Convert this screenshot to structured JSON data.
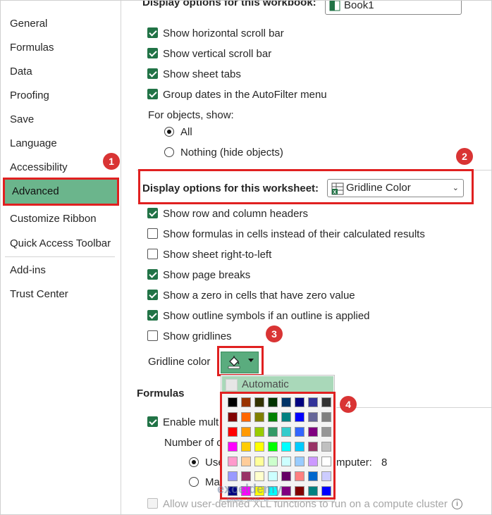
{
  "sidebar": {
    "items": [
      {
        "label": "General"
      },
      {
        "label": "Formulas"
      },
      {
        "label": "Data"
      },
      {
        "label": "Proofing"
      },
      {
        "label": "Save"
      },
      {
        "label": "Language"
      },
      {
        "label": "Accessibility"
      },
      {
        "label": "Advanced"
      },
      {
        "label": "Customize Ribbon"
      },
      {
        "label": "Quick Access Toolbar"
      },
      {
        "label": "Add-ins"
      },
      {
        "label": "Trust Center"
      }
    ],
    "active": "Advanced"
  },
  "top_cut": {
    "heading": "Display options for this workbook:",
    "combo_value": "Book1"
  },
  "workbook_options": [
    {
      "label": "Show horizontal scroll bar",
      "checked": true
    },
    {
      "label": "Show vertical scroll bar",
      "checked": true
    },
    {
      "label": "Show sheet tabs",
      "checked": true
    },
    {
      "label": "Group dates in the AutoFilter menu",
      "checked": true
    }
  ],
  "objects": {
    "label": "For objects, show:",
    "options": [
      {
        "label": "All",
        "selected": true
      },
      {
        "label": "Nothing (hide objects)",
        "selected": false
      }
    ]
  },
  "worksheet": {
    "heading": "Display options for this worksheet:",
    "combo_value": "Gridline Color",
    "options": [
      {
        "label": "Show row and column headers",
        "checked": true
      },
      {
        "label": "Show formulas in cells instead of their calculated results",
        "checked": false
      },
      {
        "label": "Show sheet right-to-left",
        "checked": false
      },
      {
        "label": "Show page breaks",
        "checked": true
      },
      {
        "label": "Show a zero in cells that have zero value",
        "checked": true
      },
      {
        "label": "Show outline symbols if an outline is applied",
        "checked": true
      },
      {
        "label": "Show gridlines",
        "checked": false
      }
    ],
    "gridline_color_label": "Gridline color"
  },
  "formulas": {
    "heading": "Formulas",
    "enable_multithread": "Enable mult",
    "number_of": "Number of c",
    "use_all": "Use",
    "computer_label": "mputer:",
    "computer_value": "8",
    "manual": "Ma",
    "allow_udf": "Allow user-defined XLL functions to run on a compute cluster",
    "info_icon": "i"
  },
  "palette": {
    "automatic_label": "Automatic",
    "colors": [
      [
        "#000000",
        "#993300",
        "#333300",
        "#003300",
        "#003366",
        "#000080",
        "#333399",
        "#333333"
      ],
      [
        "#800000",
        "#FF6600",
        "#808000",
        "#008000",
        "#008080",
        "#0000FF",
        "#666699",
        "#808080"
      ],
      [
        "#FF0000",
        "#FF9900",
        "#99CC00",
        "#339966",
        "#33CCCC",
        "#3366FF",
        "#800080",
        "#969696"
      ],
      [
        "#FF00FF",
        "#FFCC00",
        "#FFFF00",
        "#00FF00",
        "#00FFFF",
        "#00CCFF",
        "#993366",
        "#C0C0C0"
      ],
      [
        "#FF99CC",
        "#FFCC99",
        "#FFFF99",
        "#CCFFCC",
        "#CCFFFF",
        "#99CCFF",
        "#CC99FF",
        "#FFFFFF"
      ],
      [
        "#9999FF",
        "#993366",
        "#FFFFCC",
        "#CCFFFF",
        "#660066",
        "#FF8080",
        "#0066CC",
        "#CCCCFF"
      ],
      [
        "#000080",
        "#FF00FF",
        "#FFFF00",
        "#00FFFF",
        "#800080",
        "#800000",
        "#008080",
        "#0000FF"
      ]
    ]
  },
  "callouts": {
    "one": "1",
    "two": "2",
    "three": "3",
    "four": "4"
  },
  "watermark": {
    "brand": "exceldemy",
    "tagline": "EXCEL · DATA · BI"
  },
  "colors": {
    "accent": "#217346",
    "highlight": "#6bb58c",
    "callout": "#d93434"
  }
}
